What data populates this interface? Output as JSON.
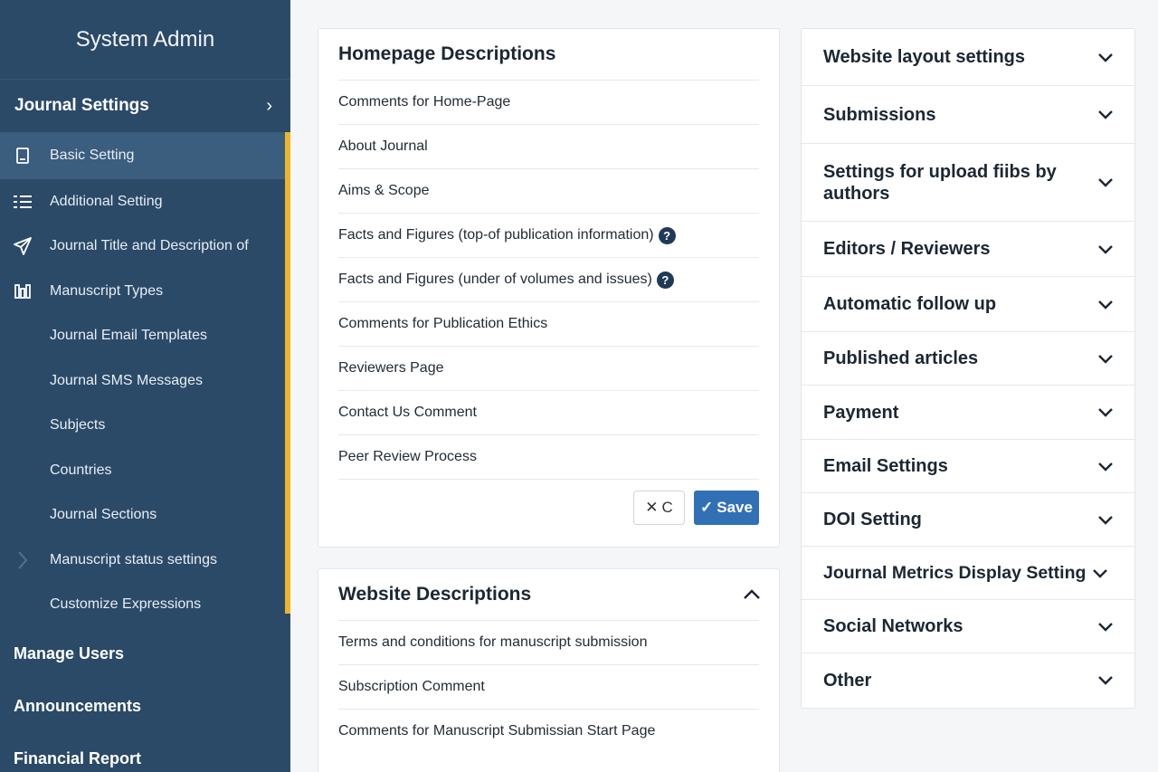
{
  "sidebar": {
    "title": "System Admin",
    "section": "Journal Settings",
    "items": [
      {
        "label": "Basic Setting",
        "icon": "document-icon"
      },
      {
        "label": "Additional Setting",
        "icon": "list-icon"
      },
      {
        "label": "Journal Title and Description of",
        "icon": "send-icon"
      },
      {
        "label": "Manuscript Types",
        "icon": "columns-icon"
      },
      {
        "label": "Journal Email Templates"
      },
      {
        "label": "Journal SMS Messages"
      },
      {
        "label": "Subjects"
      },
      {
        "label": "Countries"
      },
      {
        "label": "Journal Sections"
      },
      {
        "label": "Manuscript status settings",
        "icon": "chevron-right-icon"
      },
      {
        "label": "Customize Expressions"
      }
    ],
    "main": [
      "Manage Users",
      "Announcements",
      "Financial Report"
    ]
  },
  "homepage": {
    "title": "Homepage Descriptions",
    "rows": [
      "Comments for Home-Page",
      "About Journal",
      "Aims & Scope",
      "Facts and Figures (top-of publication information)",
      "Facts and Figures (under of volumes and issues)",
      "Comments for Publication Ethics",
      "Reviewers Page",
      "Contact Us Comment",
      "Peer Review Process"
    ],
    "help_glyph": "?",
    "cancel_label": "C",
    "save_label": "Save"
  },
  "website": {
    "title": "Website Descriptions",
    "rows": [
      "Terms and conditions for manuscript submission",
      "Subscription Comment",
      "Comments for Manuscript Submissian Start Page"
    ]
  },
  "accordion": [
    "Website layout settings",
    "Submissions",
    "Settings for upload fiibs by authors",
    "Editors / Reviewers",
    "Automatic follow up",
    "Published articles",
    "Payment",
    "Email Settings",
    "DOI Setting",
    "Journal Metrics Display Setting",
    "Social Networks",
    "Other"
  ],
  "colors": {
    "sidebar": "#2b4a68",
    "accent": "#f0b429",
    "save": "#3270b6"
  }
}
